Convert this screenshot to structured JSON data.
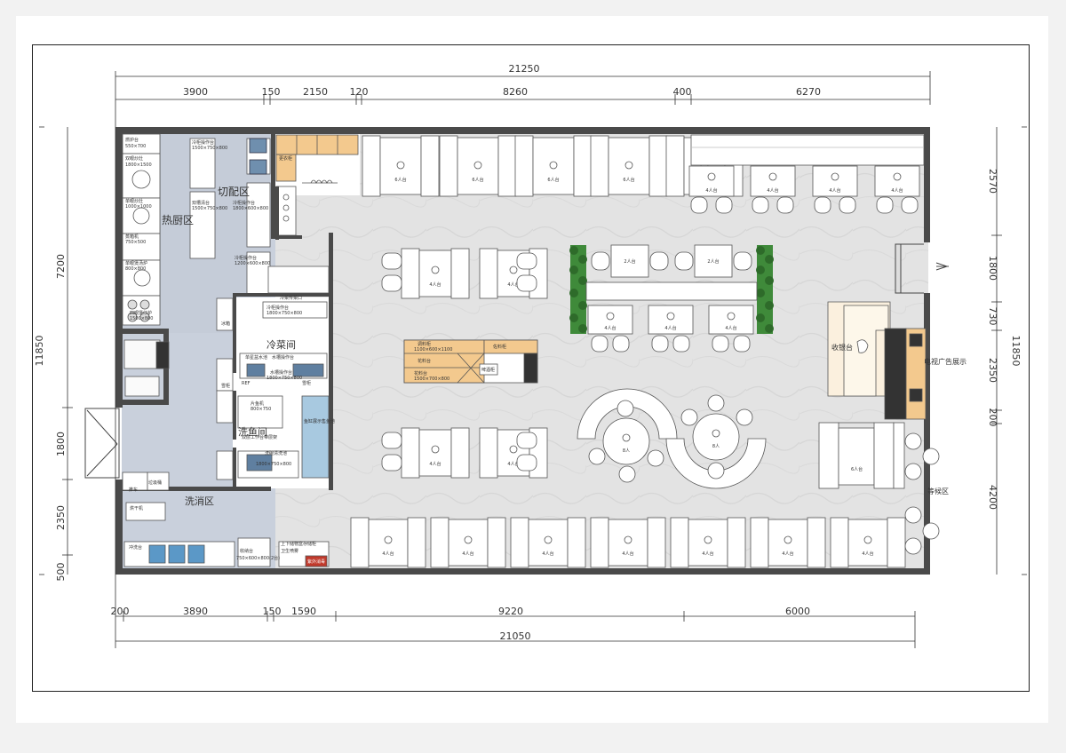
{
  "dimensions": {
    "top_total": "21250",
    "top_segments": [
      "3900",
      "150",
      "2150",
      "120",
      "8260",
      "400",
      "6270"
    ],
    "bottom_segments": [
      "200",
      "3890",
      "150",
      "1590",
      "9220",
      "6000"
    ],
    "bottom_total": "21050",
    "left_total": "11850",
    "left_segments": [
      "7200",
      "1800",
      "2350",
      "500"
    ],
    "right_total": "11850",
    "right_segments": [
      "2570",
      "1800",
      "730",
      "2350",
      "200",
      "4200"
    ]
  },
  "zones": {
    "hot_kitchen": "热厨区",
    "prep": "切配区",
    "cold_dish": "冷菜间",
    "fish_room": "洗鱼间",
    "dishwash": "洗消区",
    "changing": "更衣柜",
    "cashier": "收银台",
    "tv_display": "电视广告展示",
    "waiting": "等候区"
  },
  "kitchen_labels": {
    "stove_top": "燃炉台",
    "stove_top_size": "550×700",
    "double_wok": "双眼炒灶",
    "double_wok_size": "1800×1500",
    "single_wok": "单眼炒灶",
    "single_wok_size": "1000×1000",
    "steamer": "蒸箱机",
    "steamer_size": "750×500",
    "single_soup": "单眼煲汤炉",
    "single_soup_size": "800×800",
    "four_stove": "四眼煲仔炉",
    "four_stove_size": "1500×800",
    "cold_bench": "冷柜操作台",
    "cold_bench_size": "1500×750×800",
    "double_sink": "双槽清台",
    "double_sink_size": "1500×750×800",
    "cold_bench2": "冷柜操作台",
    "cold_bench2_size": "1800×600×800",
    "cold_bench3": "冷柜操作台",
    "cold_bench3_size": "1200×600×800",
    "cold_window": "冷菜传菜口",
    "cold_bench4": "冷柜操作台",
    "cold_bench4_size": "1800×750×800",
    "single_sink": "单星盆水池",
    "sink_bench": "水槽操作台",
    "sink_bench2": "水槽操作台",
    "sink_bench2_size": "1800×750×800",
    "fish_bench": "片鱼机",
    "fish_bench_size": "800×750",
    "fish_tank": "鱼缸展示售鱼池",
    "double_work": "双层工作台带层架",
    "dish_sink": "洗碗清洗池",
    "dish_sink_size": "1800×750×800",
    "cart": "推车",
    "trash": "垃圾桶",
    "dryer": "烘干机",
    "rinse": "冲洗台",
    "cashier_small": "收纳台",
    "cashier_small_size": "750×600×800(2台)",
    "disinfect": "紫外消毒",
    "spray": "卫生喷雾",
    "plant_cabinet": "上下储物盒存储柜",
    "fridge": "冰箱",
    "fridge2": "雪柜",
    "ref": "REF",
    "freezer_small": "雪柜"
  },
  "sauce_station": {
    "sauce": "调料柜",
    "sauce_size": "1100×600×1100",
    "spice": "佐料柜",
    "bench": "花料台",
    "bench_size": "1500×700×800",
    "ice": "冰柜",
    "beer": "啤酒柜"
  },
  "table_labels": {
    "six": "6人台",
    "four": "4人台",
    "two": "2人台",
    "eight": "8人"
  }
}
